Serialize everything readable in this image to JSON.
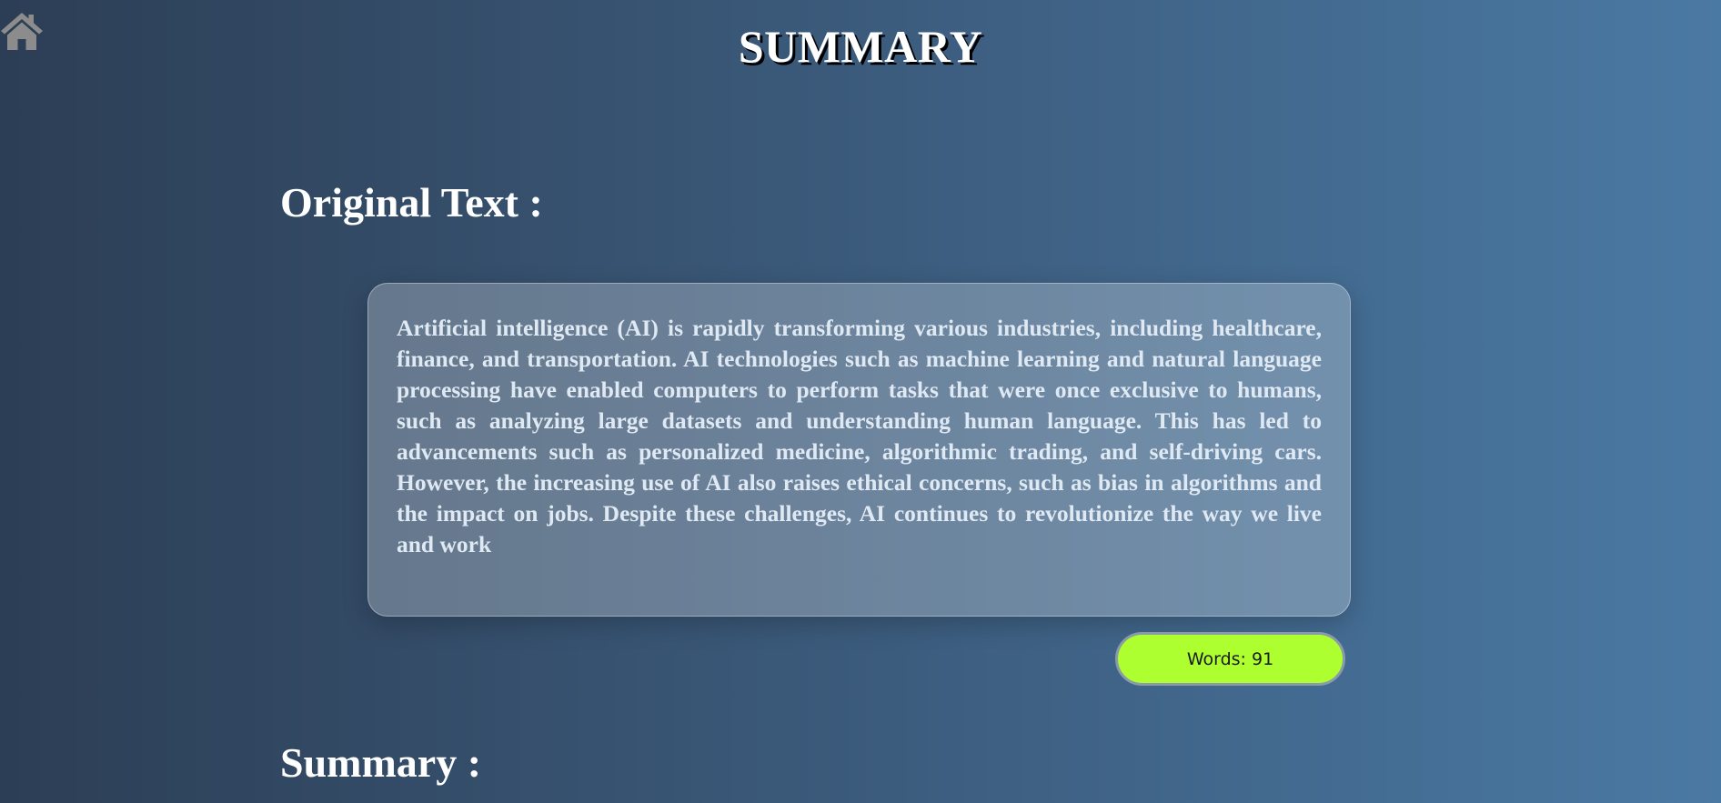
{
  "header": {
    "title": "SUMMARY",
    "home_icon": "home-icon",
    "home_icon_color": "#8c8c8c"
  },
  "original": {
    "heading": "Original Text :",
    "text": "Artificial intelligence (AI) is rapidly transforming various industries, including healthcare, finance, and transportation. AI technologies such as machine learning and natural language processing have enabled computers to perform tasks that were once exclusive to humans, such as analyzing large datasets and understanding human language. This has led to advancements such as personalized medicine, algorithmic trading, and self-driving cars. However, the increasing use of AI also raises ethical concerns, such as bias in algorithms and the impact on jobs. Despite these challenges, AI continues to revolutionize the way we live and work",
    "word_count_label": "Words: 91",
    "word_count": 91
  },
  "summary": {
    "heading": "Summary :"
  },
  "colors": {
    "background_start": "#2c3e55",
    "background_end": "#4a79a3",
    "badge": "#adff2f",
    "card_text": "#dfe9f3"
  }
}
